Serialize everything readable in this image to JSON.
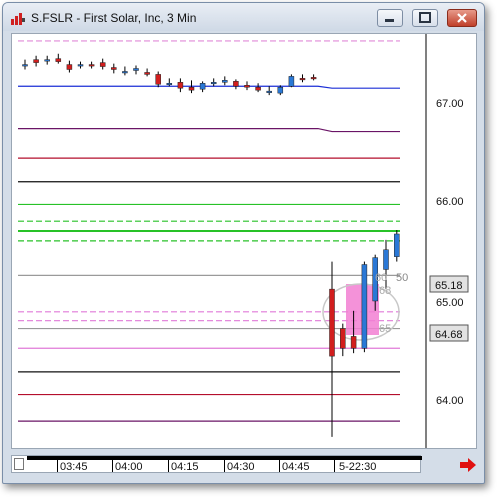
{
  "window": {
    "title": "S.FSLR - First Solar, Inc, 3 Min"
  },
  "time_axis": {
    "labels": [
      "03:45",
      "04:00",
      "04:15",
      "04:30",
      "04:45",
      "5-22:30"
    ]
  },
  "price_axis": {
    "labels": [
      "67.00",
      "66.00",
      "65.00",
      "64.00"
    ],
    "badges": [
      "65.18",
      "64.68"
    ]
  },
  "overlay_labels": {
    "top": "50",
    "top_partial": "60",
    "mid": "68",
    "low": "65"
  },
  "chart_data": {
    "type": "candlestick",
    "title": "S.FSLR - First Solar, Inc, 3 Min",
    "y_ticks": [
      67.0,
      66.0,
      65.0,
      64.0
    ],
    "ylim": [
      63.6,
      67.65
    ],
    "price_badges": [
      65.18,
      64.68
    ],
    "candles": [
      {
        "o": 67.38,
        "h": 67.43,
        "l": 67.33,
        "c": 67.38,
        "color": "blue"
      },
      {
        "o": 67.43,
        "h": 67.47,
        "l": 67.36,
        "c": 67.4,
        "color": "red"
      },
      {
        "o": 67.42,
        "h": 67.47,
        "l": 67.38,
        "c": 67.43,
        "color": "blue"
      },
      {
        "o": 67.44,
        "h": 67.49,
        "l": 67.39,
        "c": 67.41,
        "color": "red"
      },
      {
        "o": 67.38,
        "h": 67.42,
        "l": 67.3,
        "c": 67.33,
        "color": "red"
      },
      {
        "o": 67.38,
        "h": 67.41,
        "l": 67.34,
        "c": 67.38,
        "color": "blue"
      },
      {
        "o": 67.38,
        "h": 67.41,
        "l": 67.34,
        "c": 67.38,
        "color": "red"
      },
      {
        "o": 67.4,
        "h": 67.44,
        "l": 67.33,
        "c": 67.36,
        "color": "red"
      },
      {
        "o": 67.33,
        "h": 67.39,
        "l": 67.29,
        "c": 67.35,
        "color": "red"
      },
      {
        "o": 67.31,
        "h": 67.36,
        "l": 67.27,
        "c": 67.31,
        "color": "blue"
      },
      {
        "o": 67.32,
        "h": 67.37,
        "l": 67.28,
        "c": 67.34,
        "color": "blue"
      },
      {
        "o": 67.3,
        "h": 67.34,
        "l": 67.26,
        "c": 67.28,
        "color": "red"
      },
      {
        "o": 67.28,
        "h": 67.31,
        "l": 67.15,
        "c": 67.18,
        "color": "red"
      },
      {
        "o": 67.19,
        "h": 67.24,
        "l": 67.16,
        "c": 67.19,
        "color": "blue"
      },
      {
        "o": 67.2,
        "h": 67.24,
        "l": 67.1,
        "c": 67.14,
        "color": "red"
      },
      {
        "o": 67.15,
        "h": 67.22,
        "l": 67.09,
        "c": 67.12,
        "color": "red"
      },
      {
        "o": 67.13,
        "h": 67.21,
        "l": 67.1,
        "c": 67.19,
        "color": "blue"
      },
      {
        "o": 67.2,
        "h": 67.24,
        "l": 67.16,
        "c": 67.2,
        "color": "blue"
      },
      {
        "o": 67.2,
        "h": 67.26,
        "l": 67.17,
        "c": 67.22,
        "color": "blue"
      },
      {
        "o": 67.21,
        "h": 67.23,
        "l": 67.13,
        "c": 67.16,
        "color": "red"
      },
      {
        "o": 67.17,
        "h": 67.21,
        "l": 67.12,
        "c": 67.15,
        "color": "red"
      },
      {
        "o": 67.15,
        "h": 67.19,
        "l": 67.1,
        "c": 67.12,
        "color": "red"
      },
      {
        "o": 67.11,
        "h": 67.16,
        "l": 67.07,
        "c": 67.1,
        "color": "blue"
      },
      {
        "o": 67.09,
        "h": 67.17,
        "l": 67.07,
        "c": 67.15,
        "color": "blue"
      },
      {
        "o": 67.16,
        "h": 67.28,
        "l": 67.15,
        "c": 67.26,
        "color": "blue"
      },
      {
        "o": 67.24,
        "h": 67.28,
        "l": 67.2,
        "c": 67.24,
        "color": "red"
      },
      {
        "o": 67.25,
        "h": 67.28,
        "l": 67.22,
        "c": 67.25,
        "color": "red"
      },
      {
        "o": 65.1,
        "h": 65.38,
        "l": 63.6,
        "c": 64.42,
        "color": "red"
      },
      {
        "o": 64.7,
        "h": 64.75,
        "l": 64.42,
        "c": 64.5,
        "color": "red"
      },
      {
        "o": 64.62,
        "h": 64.88,
        "l": 64.45,
        "c": 64.5,
        "color": "red"
      },
      {
        "o": 64.5,
        "h": 65.38,
        "l": 64.46,
        "c": 65.35,
        "color": "blue"
      },
      {
        "o": 64.98,
        "h": 65.45,
        "l": 64.88,
        "c": 65.42,
        "color": "blue"
      },
      {
        "o": 65.3,
        "h": 65.6,
        "l": 65.1,
        "c": 65.5,
        "color": "blue"
      },
      {
        "o": 65.43,
        "h": 65.7,
        "l": 65.38,
        "c": 65.66,
        "color": "blue"
      }
    ],
    "levels": [
      {
        "price": 67.62,
        "color": "#e08ad8",
        "style": "dash"
      },
      {
        "price": 67.16,
        "color": "#1b2fd6",
        "style": "solid",
        "shift": -0.02
      },
      {
        "price": 66.73,
        "color": "#6a1466",
        "style": "solid",
        "shift": -0.03
      },
      {
        "price": 66.43,
        "color": "#b40e2c",
        "style": "solid"
      },
      {
        "price": 66.19,
        "color": "#111111",
        "style": "solid"
      },
      {
        "price": 65.96,
        "color": "#28c228",
        "style": "solid"
      },
      {
        "price": 65.79,
        "color": "#28c228",
        "style": "dash"
      },
      {
        "price": 65.69,
        "color": "#28c228",
        "style": "solid",
        "width": 2
      },
      {
        "price": 65.59,
        "color": "#28c228",
        "style": "dash"
      },
      {
        "price": 65.24,
        "color": "#9a9a9a",
        "style": "solid"
      },
      {
        "price": 64.87,
        "color": "#e07ad8",
        "style": "dash"
      },
      {
        "price": 64.78,
        "color": "#e07ad8",
        "style": "dash"
      },
      {
        "price": 64.7,
        "color": "#9a9a9a",
        "style": "solid"
      },
      {
        "price": 64.5,
        "color": "#e07ad8",
        "style": "solid"
      },
      {
        "price": 64.26,
        "color": "#111111",
        "style": "solid"
      },
      {
        "price": 64.03,
        "color": "#b40e2c",
        "style": "solid"
      },
      {
        "price": 63.76,
        "color": "#6a1466",
        "style": "solid"
      }
    ]
  },
  "colors": {
    "candle_up": "#2a78d6",
    "candle_down": "#d21e1e",
    "zone_fill": "#f27fd2",
    "window_frame": "#d4dde8",
    "accent_arrow": "#e01010"
  }
}
